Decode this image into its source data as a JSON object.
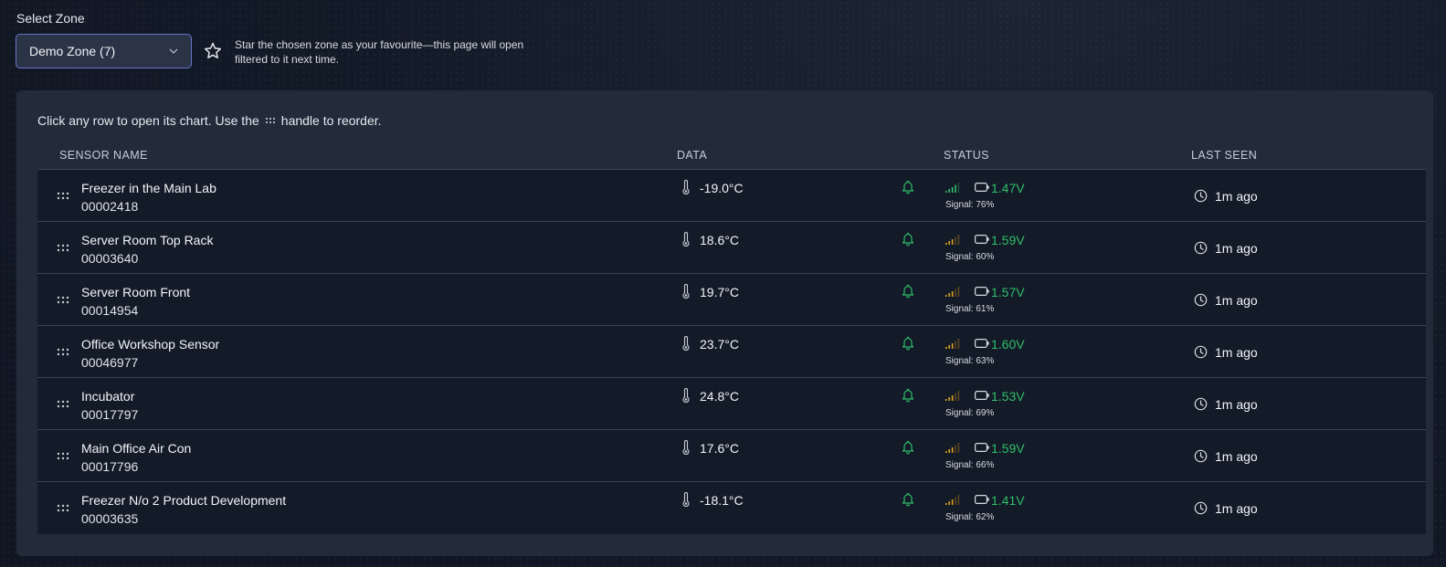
{
  "zone": {
    "label": "Select Zone",
    "selected": "Demo Zone (7)",
    "favourite_text": "Star the chosen zone as your favourite—this page will open filtered to it next time."
  },
  "panel": {
    "hint_before": "Click any row to open its chart. Use the",
    "hint_after": "handle to reorder.",
    "columns": {
      "name": "SENSOR NAME",
      "data": "DATA",
      "status": "STATUS",
      "last_seen": "LAST SEEN"
    }
  },
  "colors": {
    "accent_green": "#2fbf6a",
    "signal_teal": "#2fbf6a",
    "signal_orange": "#e0a020",
    "select_border": "#6a74c9"
  },
  "icons": {
    "grip": "grip-icon",
    "thermometer": "thermometer-icon",
    "bell": "bell-icon",
    "signal": "signal-bars-icon",
    "battery": "battery-icon",
    "clock": "clock-icon",
    "star": "star-icon",
    "chevron": "chevron-down-icon"
  },
  "sensors": [
    {
      "name": "Freezer in the Main Lab",
      "id": "00002418",
      "temp": "-19.0°C",
      "voltage": "1.47V",
      "signal": "Signal: 76%",
      "signal_level": 0.76,
      "signal_color": "teal",
      "last_seen": "1m ago"
    },
    {
      "name": "Server Room Top Rack",
      "id": "00003640",
      "temp": "18.6°C",
      "voltage": "1.59V",
      "signal": "Signal: 60%",
      "signal_level": 0.6,
      "signal_color": "orange",
      "last_seen": "1m ago"
    },
    {
      "name": "Server Room Front",
      "id": "00014954",
      "temp": "19.7°C",
      "voltage": "1.57V",
      "signal": "Signal: 61%",
      "signal_level": 0.61,
      "signal_color": "orange",
      "last_seen": "1m ago"
    },
    {
      "name": "Office Workshop Sensor",
      "id": "00046977",
      "temp": "23.7°C",
      "voltage": "1.60V",
      "signal": "Signal: 63%",
      "signal_level": 0.63,
      "signal_color": "orange",
      "last_seen": "1m ago"
    },
    {
      "name": "Incubator",
      "id": "00017797",
      "temp": "24.8°C",
      "voltage": "1.53V",
      "signal": "Signal: 69%",
      "signal_level": 0.69,
      "signal_color": "orange",
      "last_seen": "1m ago"
    },
    {
      "name": "Main Office Air Con",
      "id": "00017796",
      "temp": "17.6°C",
      "voltage": "1.59V",
      "signal": "Signal: 66%",
      "signal_level": 0.66,
      "signal_color": "orange",
      "last_seen": "1m ago"
    },
    {
      "name": "Freezer N/o 2 Product Development",
      "id": "00003635",
      "temp": "-18.1°C",
      "voltage": "1.41V",
      "signal": "Signal: 62%",
      "signal_level": 0.62,
      "signal_color": "orange",
      "last_seen": "1m ago"
    }
  ]
}
